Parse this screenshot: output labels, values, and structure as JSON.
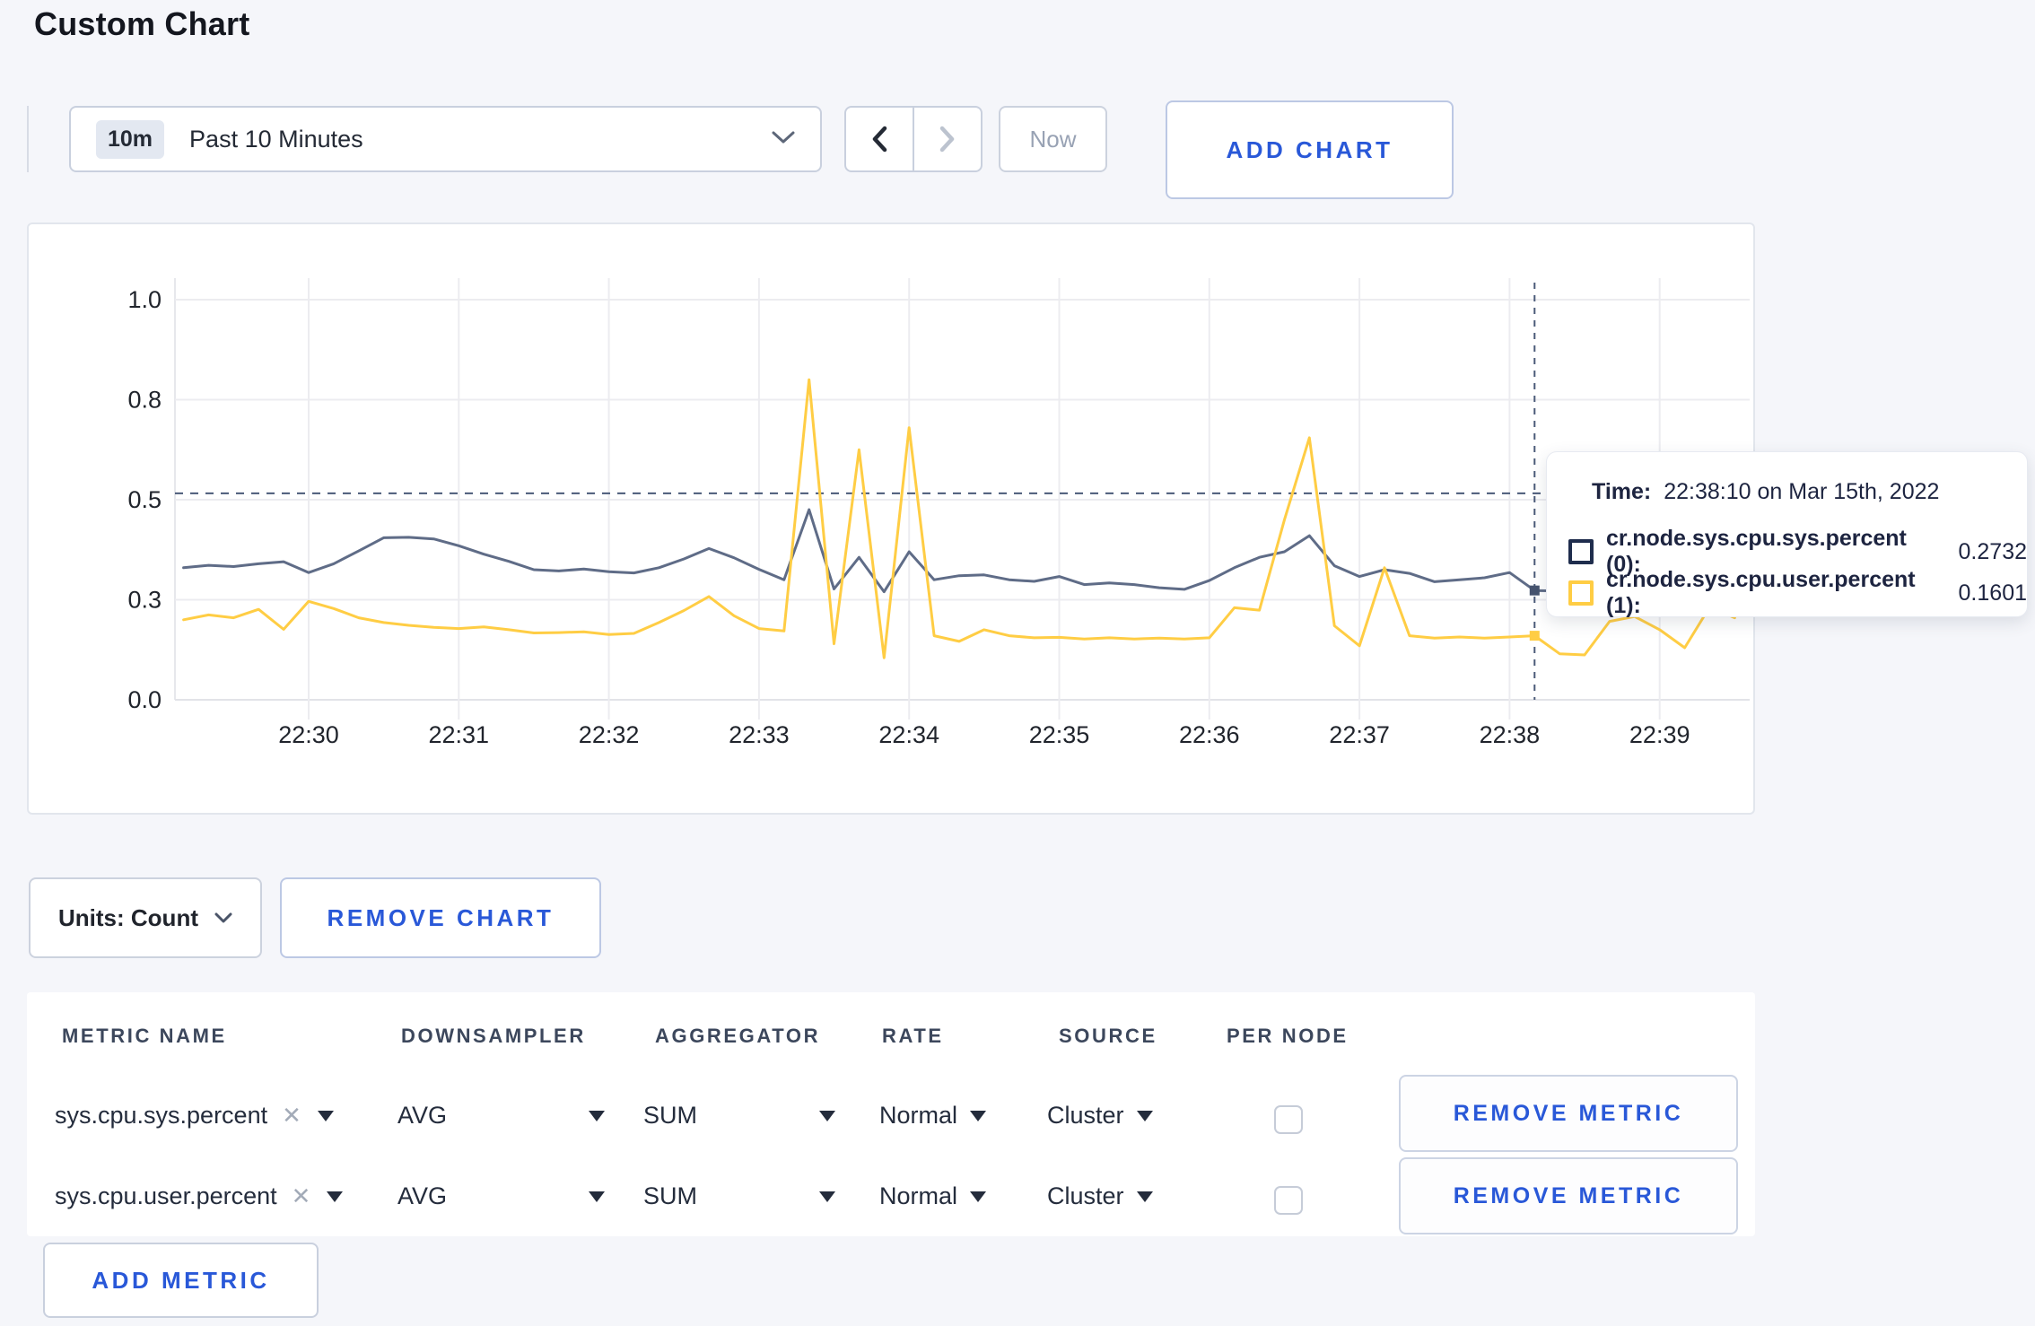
{
  "page": {
    "title": "Custom Chart"
  },
  "toolbar": {
    "range_badge": "10m",
    "range_label": "Past 10 Minutes",
    "now_label": "Now",
    "add_chart_label": "ADD CHART"
  },
  "chart": {
    "tooltip": {
      "time_label": "Time:",
      "time_value": "22:38:10 on Mar 15th, 2022",
      "series": [
        {
          "label": "cr.node.sys.cpu.sys.percent (0):",
          "value": "0.2732",
          "color": "#1f2d4d"
        },
        {
          "label": "cr.node.sys.cpu.user.percent (1):",
          "value": "0.1601",
          "color": "#ffcd44"
        }
      ]
    }
  },
  "chart_data": {
    "type": "line",
    "title": "",
    "xlabel": "",
    "ylabel": "",
    "ylim": [
      0,
      1
    ],
    "grid": true,
    "x_ticks": [
      [
        0,
        "22:30"
      ],
      [
        60,
        "22:31"
      ],
      [
        120,
        "22:32"
      ],
      [
        180,
        "22:33"
      ],
      [
        240,
        "22:34"
      ],
      [
        300,
        "22:35"
      ],
      [
        360,
        "22:36"
      ],
      [
        420,
        "22:37"
      ],
      [
        480,
        "22:38"
      ],
      [
        540,
        "22:39"
      ]
    ],
    "y_ticks": [
      [
        0,
        "0.0"
      ],
      [
        0.25,
        "0.3"
      ],
      [
        0.5,
        "0.5"
      ],
      [
        0.75,
        "0.8"
      ],
      [
        1,
        "1.0"
      ]
    ],
    "x_start_seconds": -50,
    "x_step_seconds": 10,
    "guide_value": 0.516,
    "crosshair": {
      "t": 490,
      "time": "22:38:10 on Mar 15th, 2022",
      "sys": 0.2732,
      "user": 0.1601
    },
    "series": [
      {
        "name": "cr.node.sys.cpu.sys.percent",
        "color": "#5f6c87",
        "dot_color": "#46536e",
        "values": [
          0.33,
          0.336,
          0.333,
          0.34,
          0.345,
          0.318,
          0.34,
          0.372,
          0.405,
          0.406,
          0.402,
          0.385,
          0.364,
          0.346,
          0.325,
          0.322,
          0.327,
          0.32,
          0.317,
          0.33,
          0.352,
          0.378,
          0.355,
          0.326,
          0.3,
          0.475,
          0.277,
          0.356,
          0.27,
          0.37,
          0.3,
          0.31,
          0.312,
          0.3,
          0.296,
          0.308,
          0.288,
          0.292,
          0.288,
          0.28,
          0.276,
          0.298,
          0.33,
          0.356,
          0.37,
          0.41,
          0.335,
          0.308,
          0.325,
          0.316,
          0.295,
          0.3,
          0.305,
          0.318,
          0.2732,
          0.272,
          0.285,
          0.295,
          0.29,
          0.3,
          0.296,
          0.291,
          0.296
        ]
      },
      {
        "name": "cr.node.sys.cpu.user.percent",
        "color": "#ffcd44",
        "dot_color": "#ffcd44",
        "values": [
          0.2,
          0.212,
          0.205,
          0.226,
          0.176,
          0.246,
          0.228,
          0.205,
          0.193,
          0.186,
          0.181,
          0.178,
          0.182,
          0.175,
          0.167,
          0.168,
          0.17,
          0.163,
          0.166,
          0.193,
          0.223,
          0.258,
          0.21,
          0.178,
          0.172,
          0.8,
          0.14,
          0.625,
          0.105,
          0.68,
          0.16,
          0.146,
          0.175,
          0.16,
          0.155,
          0.156,
          0.152,
          0.155,
          0.152,
          0.154,
          0.152,
          0.155,
          0.23,
          0.224,
          0.45,
          0.655,
          0.185,
          0.135,
          0.33,
          0.16,
          0.154,
          0.157,
          0.154,
          0.157,
          0.1601,
          0.115,
          0.112,
          0.196,
          0.208,
          0.175,
          0.13,
          0.232,
          0.205
        ]
      }
    ]
  },
  "units_bar": {
    "units_label": "Units: Count",
    "remove_chart_label": "REMOVE CHART"
  },
  "metrics_table": {
    "headers": [
      "METRIC NAME",
      "DOWNSAMPLER",
      "AGGREGATOR",
      "RATE",
      "SOURCE",
      "PER NODE"
    ],
    "clear_glyph": "✕",
    "rows": [
      {
        "metric": "sys.cpu.sys.percent",
        "downsampler": "AVG",
        "aggregator": "SUM",
        "rate": "Normal",
        "source": "Cluster",
        "per_node": false,
        "remove_label": "REMOVE METRIC"
      },
      {
        "metric": "sys.cpu.user.percent",
        "downsampler": "AVG",
        "aggregator": "SUM",
        "rate": "Normal",
        "source": "Cluster",
        "per_node": false,
        "remove_label": "REMOVE METRIC"
      }
    ],
    "add_metric_label": "ADD METRIC"
  }
}
